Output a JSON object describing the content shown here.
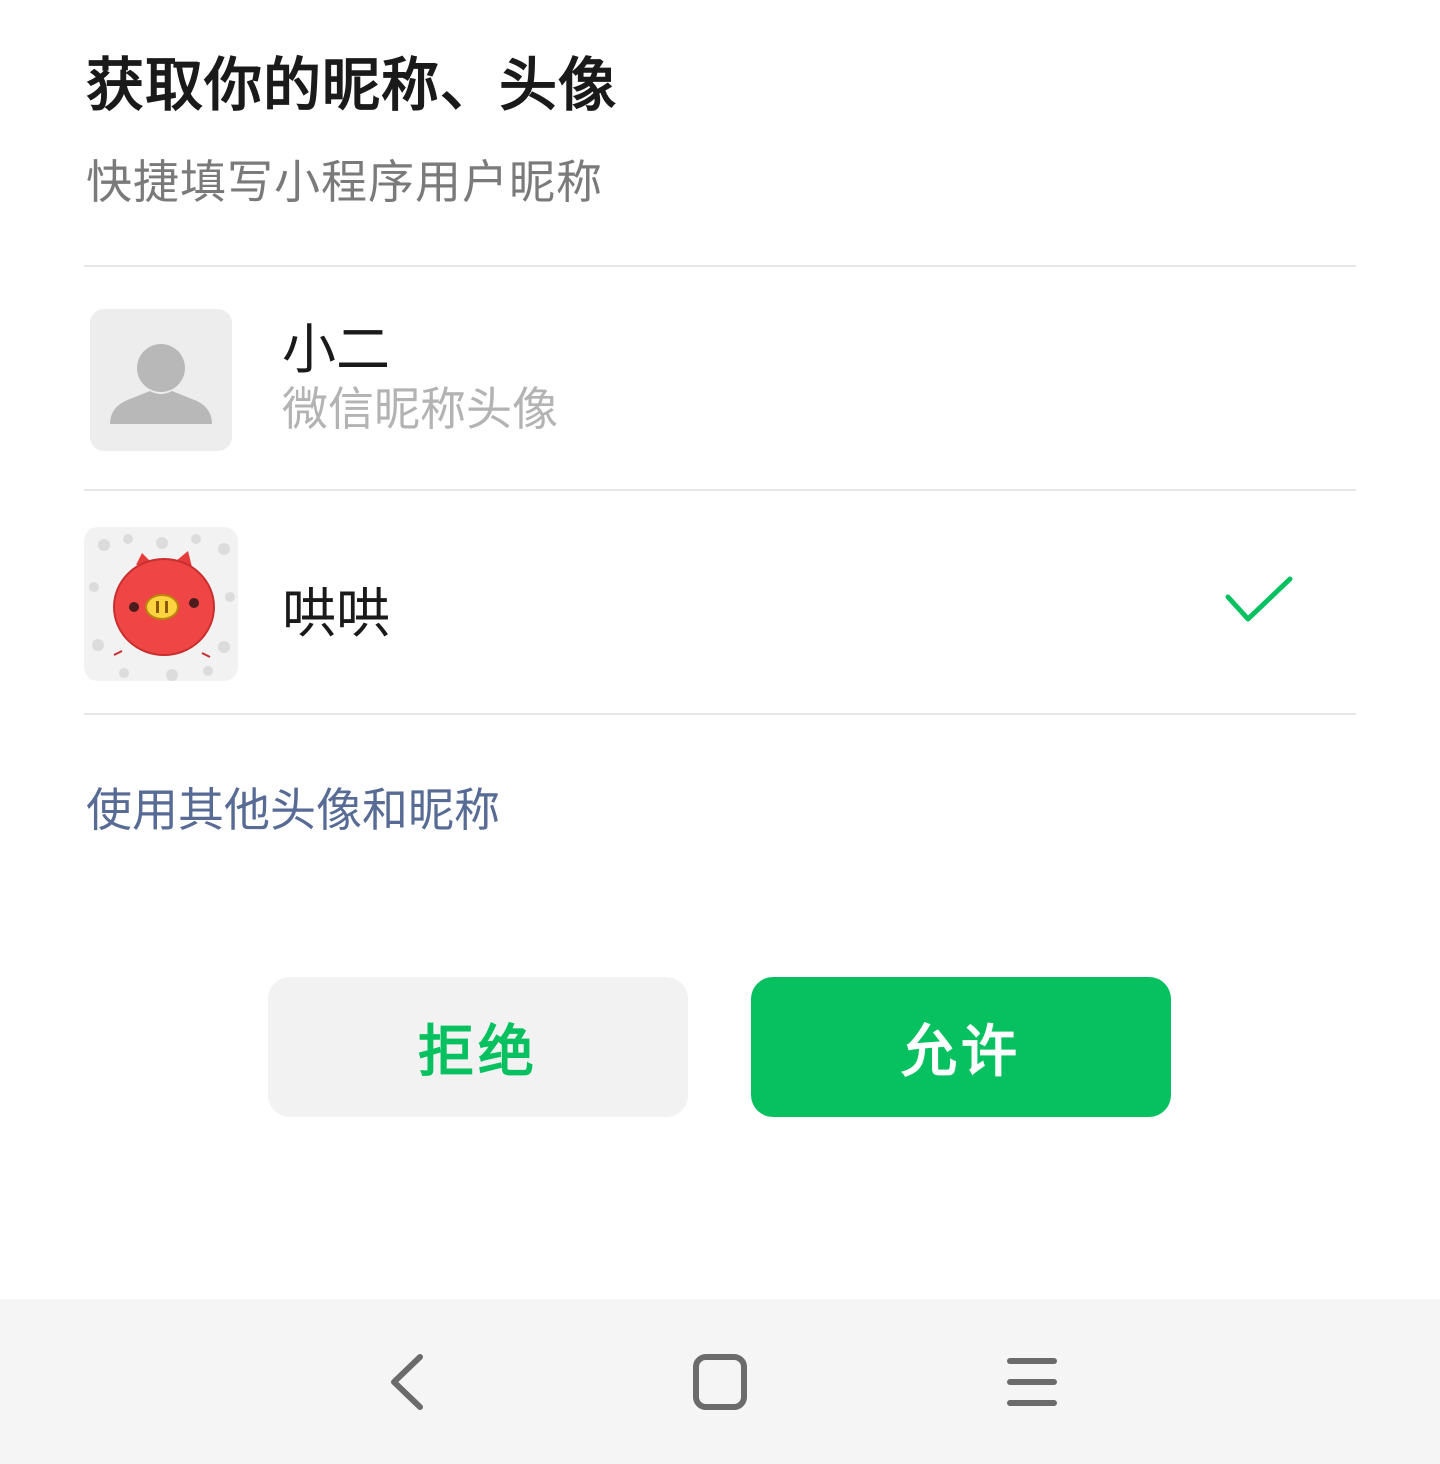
{
  "dialog": {
    "title": "获取你的昵称、头像",
    "subtitle": "快捷填写小程序用户昵称"
  },
  "options": [
    {
      "name": "小二",
      "description": "微信昵称头像",
      "avatar_icon": "default-user-avatar-icon",
      "selected": false
    },
    {
      "name": "哄哄",
      "description": "",
      "avatar_icon": "red-pig-avatar-icon",
      "selected": true
    }
  ],
  "other_option_label": "使用其他头像和昵称",
  "buttons": {
    "reject_label": "拒绝",
    "allow_label": "允许"
  },
  "colors": {
    "accent": "#07c160",
    "link": "#576b95",
    "reject_bg": "#f2f2f2",
    "navbar_bg": "#f5f5f5"
  },
  "navbar": {
    "icons": [
      "back-icon",
      "home-icon",
      "menu-icon"
    ]
  }
}
